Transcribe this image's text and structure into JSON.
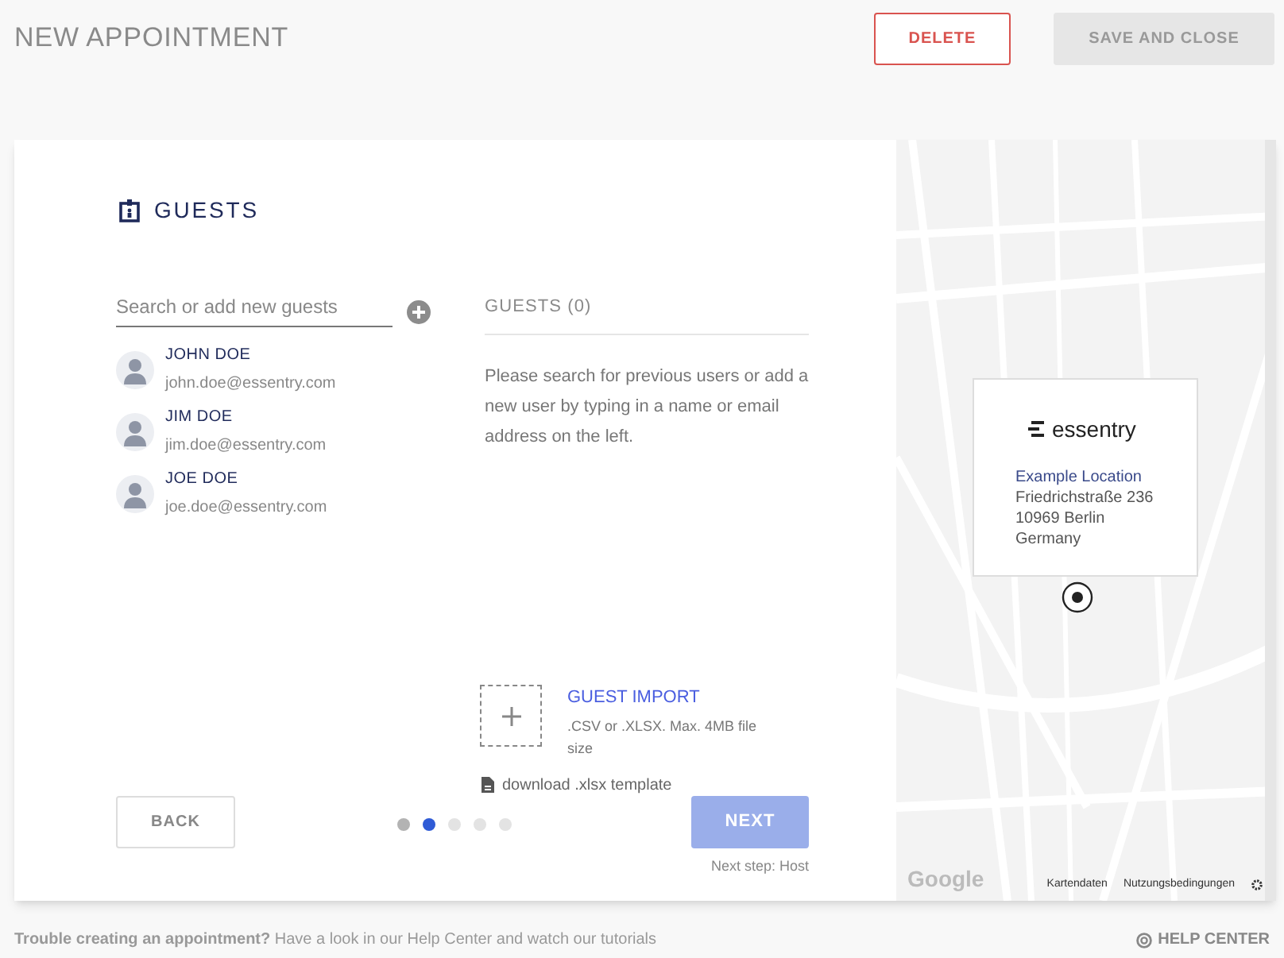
{
  "header": {
    "title": "NEW APPOINTMENT",
    "buttons": [
      {
        "kind": "danger",
        "label": "DELETE"
      },
      {
        "kind": "muted",
        "label": "SAVE AND CLOSE"
      }
    ]
  },
  "section": {
    "title": "GUESTS"
  },
  "search": {
    "placeholder": "Search or add new guests"
  },
  "suggestions": [
    {
      "name": "JOHN DOE",
      "email": "john.doe@essentry.com"
    },
    {
      "name": "JIM DOE",
      "email": "jim.doe@essentry.com"
    },
    {
      "name": "JOE DOE",
      "email": "joe.doe@essentry.com"
    }
  ],
  "guests": {
    "title": "GUESTS (0)",
    "hint": "Please search for previous users or add a new user by typing in a name or email address on the left."
  },
  "import": {
    "title": "GUEST IMPORT",
    "note": ".CSV or .XLSX. Max. 4MB file size",
    "template_link": "download .xlsx template"
  },
  "back_button": "BACK",
  "steps": [
    {
      "completed": true,
      "selected": false
    },
    {
      "completed": false,
      "selected": true
    },
    {
      "completed": false,
      "selected": false
    },
    {
      "completed": false,
      "selected": false
    },
    {
      "completed": false,
      "selected": false
    }
  ],
  "next": {
    "label": "NEXT",
    "disabled": true,
    "note": "Next step: Host"
  },
  "map": {
    "logo": "essentry",
    "location_name": "Example Location",
    "address_lines": [
      "Friedrichstraße 236",
      "10969 Berlin",
      "Germany"
    ],
    "attribution": "Google",
    "links": [
      "Kartendaten",
      "Nutzungsbedingungen"
    ]
  },
  "footer": {
    "message": "**Trouble creating an appointment?** Have a look in our Help Center and watch our tutorials",
    "help_link": "HELP CENTER"
  }
}
